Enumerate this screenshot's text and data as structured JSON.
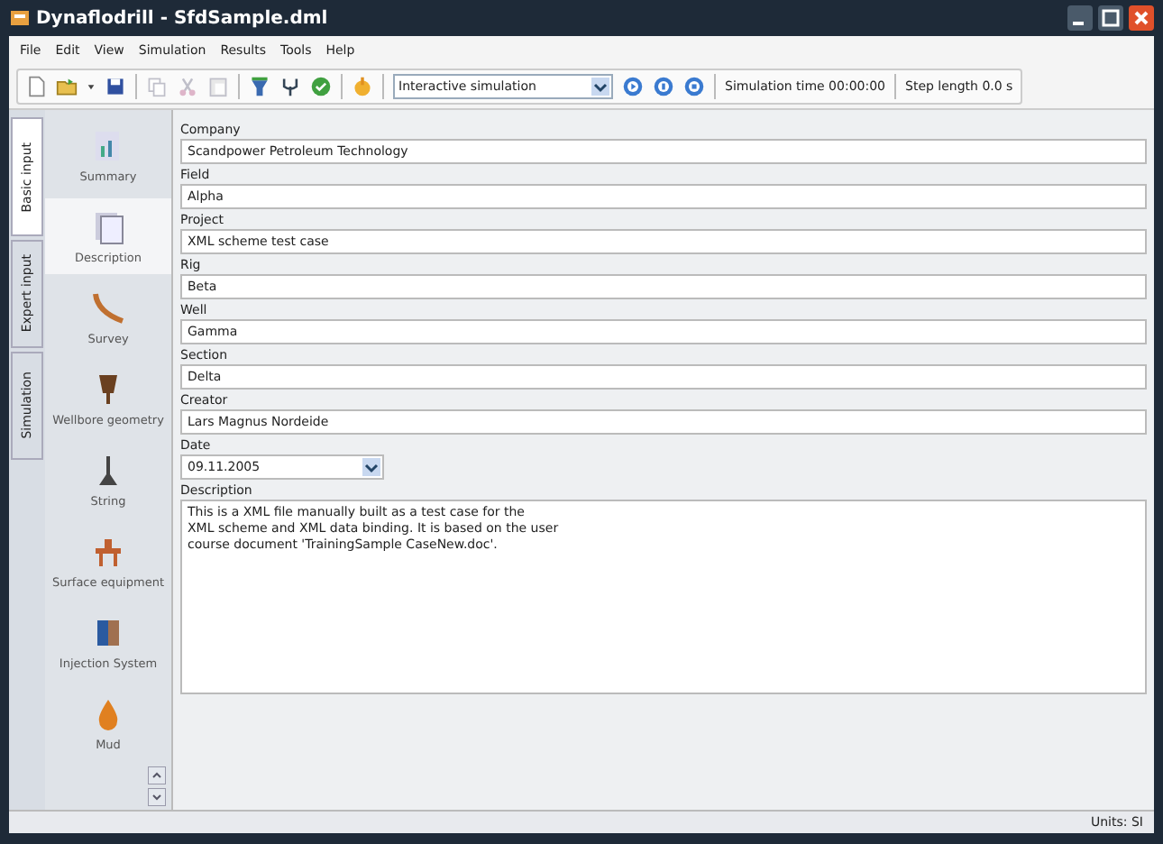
{
  "window": {
    "title": "Dynaflodrill - SfdSample.dml"
  },
  "menu": [
    "File",
    "Edit",
    "View",
    "Simulation",
    "Results",
    "Tools",
    "Help"
  ],
  "toolbar": {
    "mode": "Interactive simulation",
    "simulation_time": "Simulation time 00:00:00",
    "step_length": "Step length 0.0 s"
  },
  "side_tabs": [
    {
      "label": "Basic input",
      "selected": true
    },
    {
      "label": "Expert input",
      "selected": false
    },
    {
      "label": "Simulation",
      "selected": false
    }
  ],
  "categories": [
    {
      "label": "Summary",
      "selected": false
    },
    {
      "label": "Description",
      "selected": true
    },
    {
      "label": "Survey",
      "selected": false
    },
    {
      "label": "Wellbore geometry",
      "selected": false
    },
    {
      "label": "String",
      "selected": false
    },
    {
      "label": "Surface equipment",
      "selected": false
    },
    {
      "label": "Injection System",
      "selected": false
    },
    {
      "label": "Mud",
      "selected": false
    }
  ],
  "fields": [
    {
      "kind": "text",
      "label": "Company",
      "value": "Scandpower Petroleum Technology"
    },
    {
      "kind": "text",
      "label": "Field",
      "value": "Alpha"
    },
    {
      "kind": "text",
      "label": "Project",
      "value": "XML scheme test case"
    },
    {
      "kind": "text",
      "label": "Rig",
      "value": "Beta"
    },
    {
      "kind": "text",
      "label": "Well",
      "value": "Gamma"
    },
    {
      "kind": "text",
      "label": "Section",
      "value": "Delta"
    },
    {
      "kind": "text",
      "label": "Creator",
      "value": "Lars Magnus Nordeide"
    },
    {
      "kind": "date",
      "label": "Date",
      "value": "09.11.2005"
    },
    {
      "kind": "textarea",
      "label": "Description",
      "value": "This is a XML file manually built as a test case for the\nXML scheme and XML data binding. It is based on the user\ncourse document 'TrainingSample CaseNew.doc'."
    }
  ],
  "status_bar": {
    "units": "Units: SI"
  }
}
